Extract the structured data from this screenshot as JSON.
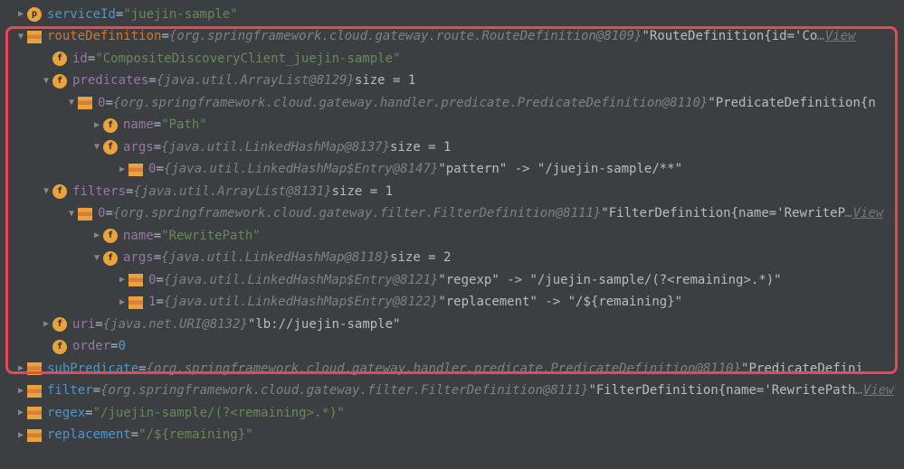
{
  "rows": [
    {
      "indent": 0,
      "arrow": "right",
      "icon": "p",
      "nameColor": "name-blue",
      "name": "serviceId",
      "eq": " = ",
      "valColor": "val-green",
      "val": "\"juejin-sample\""
    },
    {
      "indent": 0,
      "arrow": "down",
      "icon": "obj",
      "nameColor": "name-orange",
      "name": "routeDefinition",
      "eq": " = ",
      "valColor": "val-gray",
      "val": "{org.springframework.cloud.gateway.route.RouteDefinition@8109}",
      "tailColor": "val-light",
      "tail": " \"RouteDefinition{id='Co",
      "link": "View"
    },
    {
      "indent": 1,
      "arrow": "none",
      "icon": "f",
      "nameColor": "name-purple",
      "name": "id",
      "eq": " = ",
      "valColor": "val-green",
      "val": "\"CompositeDiscoveryClient_juejin-sample\""
    },
    {
      "indent": 1,
      "arrow": "down",
      "icon": "f",
      "nameColor": "name-purple",
      "name": "predicates",
      "eq": " = ",
      "valColor": "val-gray",
      "val": "{java.util.ArrayList@8129} ",
      "tailColor": "val-light",
      "tail": " size = 1"
    },
    {
      "indent": 2,
      "arrow": "down",
      "icon": "obj",
      "nameColor": "name-purple",
      "name": "0",
      "eq": " = ",
      "valColor": "val-gray",
      "val": "{org.springframework.cloud.gateway.handler.predicate.PredicateDefinition@8110}",
      "tailColor": "val-light",
      "tail": " \"PredicateDefinition{n"
    },
    {
      "indent": 3,
      "arrow": "right",
      "icon": "f",
      "nameColor": "name-purple",
      "name": "name",
      "eq": " = ",
      "valColor": "val-green",
      "val": "\"Path\""
    },
    {
      "indent": 3,
      "arrow": "down",
      "icon": "f",
      "nameColor": "name-purple",
      "name": "args",
      "eq": " = ",
      "valColor": "val-gray",
      "val": "{java.util.LinkedHashMap@8137} ",
      "tailColor": "val-light",
      "tail": " size = 1"
    },
    {
      "indent": 4,
      "arrow": "right",
      "icon": "obj",
      "nameColor": "name-purple",
      "name": "0",
      "eq": " = ",
      "valColor": "val-gray",
      "val": "{java.util.LinkedHashMap$Entry@8147}",
      "tailColor": "val-light",
      "tail": " \"pattern\" -> \"/juejin-sample/**\""
    },
    {
      "indent": 1,
      "arrow": "down",
      "icon": "f",
      "nameColor": "name-purple",
      "name": "filters",
      "eq": " = ",
      "valColor": "val-gray",
      "val": "{java.util.ArrayList@8131} ",
      "tailColor": "val-light",
      "tail": " size = 1"
    },
    {
      "indent": 2,
      "arrow": "down",
      "icon": "obj",
      "nameColor": "name-purple",
      "name": "0",
      "eq": " = ",
      "valColor": "val-gray",
      "val": "{org.springframework.cloud.gateway.filter.FilterDefinition@8111}",
      "tailColor": "val-light",
      "tail": " \"FilterDefinition{name='RewriteP",
      "link": "View"
    },
    {
      "indent": 3,
      "arrow": "right",
      "icon": "f",
      "nameColor": "name-purple",
      "name": "name",
      "eq": " = ",
      "valColor": "val-green",
      "val": "\"RewritePath\""
    },
    {
      "indent": 3,
      "arrow": "down",
      "icon": "f",
      "nameColor": "name-purple",
      "name": "args",
      "eq": " = ",
      "valColor": "val-gray",
      "val": "{java.util.LinkedHashMap@8118} ",
      "tailColor": "val-light",
      "tail": " size = 2"
    },
    {
      "indent": 4,
      "arrow": "right",
      "icon": "obj",
      "nameColor": "name-purple",
      "name": "0",
      "eq": " = ",
      "valColor": "val-gray",
      "val": "{java.util.LinkedHashMap$Entry@8121}",
      "tailColor": "val-light",
      "tail": " \"regexp\" -> \"/juejin-sample/(?<remaining>.*)\""
    },
    {
      "indent": 4,
      "arrow": "right",
      "icon": "obj",
      "nameColor": "name-purple",
      "name": "1",
      "eq": " = ",
      "valColor": "val-gray",
      "val": "{java.util.LinkedHashMap$Entry@8122}",
      "tailColor": "val-light",
      "tail": " \"replacement\" -> \"/${remaining}\""
    },
    {
      "indent": 1,
      "arrow": "right",
      "icon": "f",
      "nameColor": "name-purple",
      "name": "uri",
      "eq": " = ",
      "valColor": "val-gray",
      "val": "{java.net.URI@8132}",
      "tailColor": "val-light",
      "tail": " \"lb://juejin-sample\""
    },
    {
      "indent": 1,
      "arrow": "none",
      "icon": "f",
      "nameColor": "name-purple",
      "name": "order",
      "eq": " = ",
      "valColor": "val-num",
      "val": "0"
    },
    {
      "indent": 0,
      "arrow": "right",
      "icon": "obj",
      "nameColor": "name-blue",
      "name": "subPredicate",
      "eq": " = ",
      "valColor": "val-gray",
      "val": "{org.springframework.cloud.gateway.handler.predicate.PredicateDefinition@8110}",
      "tailColor": "val-light",
      "tail": " \"PredicateDefini"
    },
    {
      "indent": 0,
      "arrow": "right",
      "icon": "obj",
      "nameColor": "name-blue",
      "name": "filter",
      "eq": " = ",
      "valColor": "val-gray",
      "val": "{org.springframework.cloud.gateway.filter.FilterDefinition@8111}",
      "tailColor": "val-light",
      "tail": " \"FilterDefinition{name='RewritePath ",
      "link": "View"
    },
    {
      "indent": 0,
      "arrow": "right",
      "icon": "obj",
      "nameColor": "name-blue",
      "name": "regex",
      "eq": " = ",
      "valColor": "val-green",
      "val": "\"/juejin-sample/(?<remaining>.*)\""
    },
    {
      "indent": 0,
      "arrow": "right",
      "icon": "obj",
      "nameColor": "name-blue",
      "name": "replacement",
      "eq": " = ",
      "valColor": "val-green",
      "val": "\"/${remaining}\""
    }
  ],
  "iconLetters": {
    "p": "p",
    "f": "f",
    "obj": ""
  }
}
